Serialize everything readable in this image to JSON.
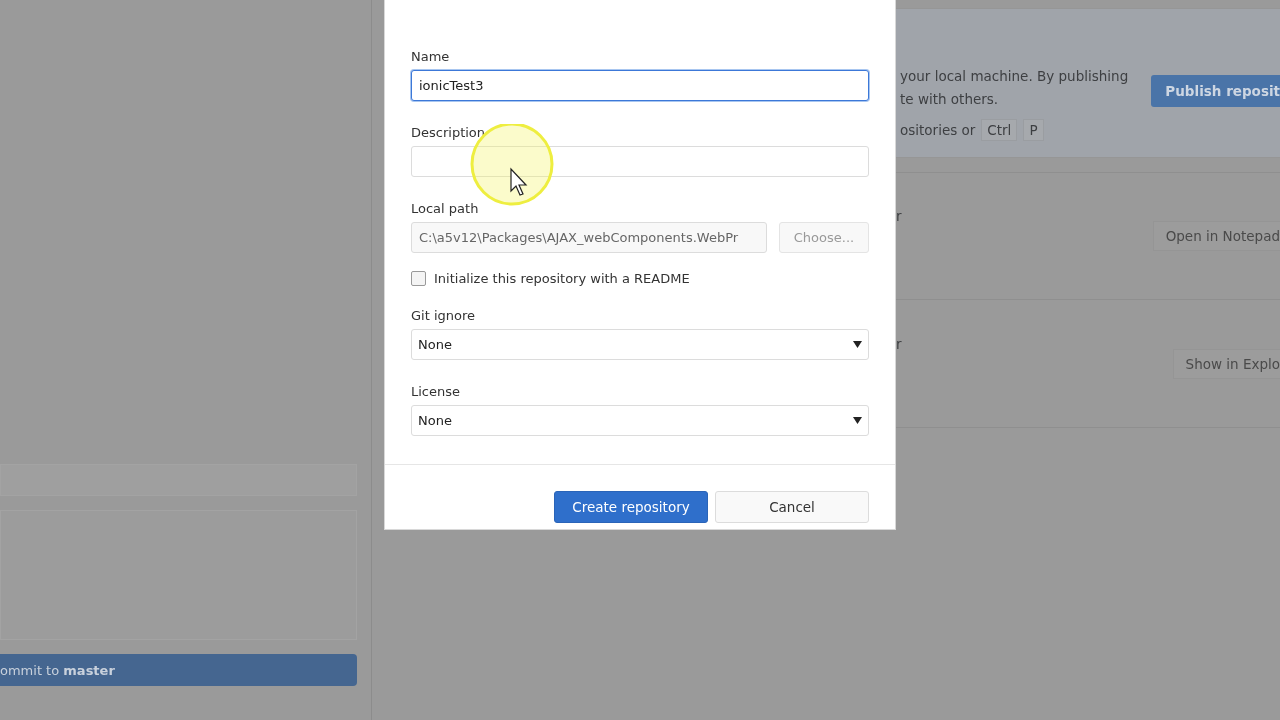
{
  "background": {
    "commit_button": "ommit to **master**",
    "publish_panel": {
      "lines": [
        "your local machine. By publishing",
        "te with others."
      ],
      "hint": "ositories or",
      "keys": [
        "Ctrl",
        "P"
      ],
      "button": "Publish reposit"
    },
    "rows": [
      {
        "text": "r",
        "button": "Open in Notepad"
      },
      {
        "text": "r",
        "button": "Show in Explo"
      }
    ]
  },
  "dialog": {
    "fields": [
      {
        "kind": "text",
        "label": "Name",
        "value": "ionicTest3",
        "focused": true
      },
      {
        "kind": "text",
        "label": "Description",
        "focused": false
      },
      {
        "kind": "path",
        "label": "Local path",
        "value": "C:\\a5v12\\Packages\\AJAX_webComponents.WebPr",
        "button": "Choose..."
      },
      {
        "kind": "checkbox",
        "label": "Initialize this repository with a README",
        "checked": false
      },
      {
        "kind": "select",
        "label": "Git ignore",
        "value": "None"
      },
      {
        "kind": "select",
        "label": "License",
        "value": "None"
      }
    ],
    "buttons": [
      {
        "label": "Create repository",
        "primary": true
      },
      {
        "label": "Cancel",
        "primary": false
      }
    ]
  }
}
